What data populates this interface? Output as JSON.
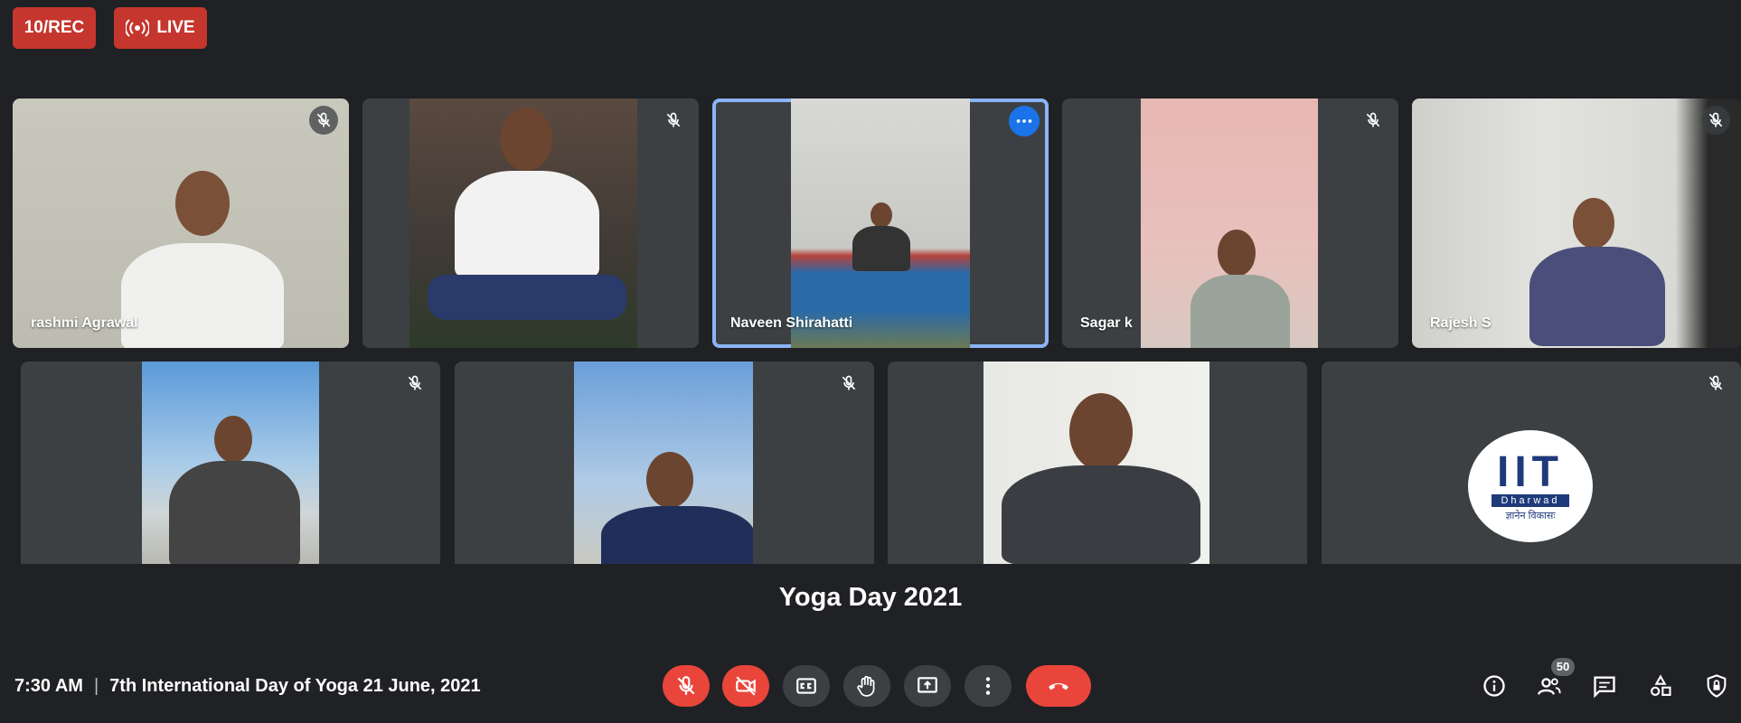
{
  "top": {
    "rec_label": "10/REC",
    "live_label": "LIVE"
  },
  "participants": [
    {
      "name": "rashmi Agrawal"
    },
    {
      "name": ""
    },
    {
      "name": "Naveen Shirahatti"
    },
    {
      "name": "Sagar k"
    },
    {
      "name": "Rajesh S"
    },
    {
      "name": ""
    },
    {
      "name": ""
    },
    {
      "name": ""
    },
    {
      "name": ""
    }
  ],
  "logo": {
    "mark_text": "IIT",
    "place_text": "Dharwad",
    "motto_text": "ज्ञानेन विकासः"
  },
  "caption": "Yoga Day 2021",
  "bottom": {
    "time": "7:30 AM",
    "separator": "|",
    "meeting_title": "7th International Day of Yoga 21 June, 2021",
    "participant_count": "50"
  },
  "colors": {
    "background": "#202124",
    "tile": "#3c4043",
    "alert_red": "#e9453a",
    "active_border": "#8ab4f8",
    "accent_blue": "#1a73e8"
  },
  "icons": {
    "controls": [
      "mic-off-icon",
      "camera-off-icon",
      "captions-icon",
      "raise-hand-icon",
      "present-icon",
      "more-options-icon",
      "end-call-icon"
    ],
    "right": [
      "info-icon",
      "people-icon",
      "chat-icon",
      "activities-icon",
      "host-controls-icon"
    ]
  }
}
